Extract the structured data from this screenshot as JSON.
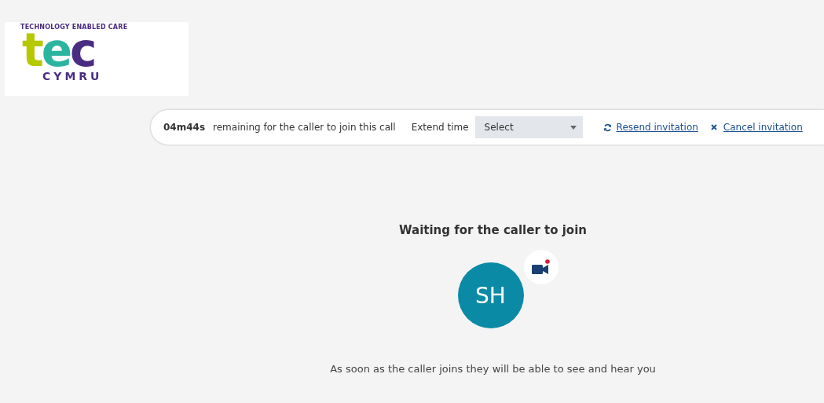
{
  "logo": {
    "tagline": "TECHNOLOGY ENABLED CARE",
    "letters": [
      {
        "text": "t",
        "color": "#b5c800"
      },
      {
        "text": "e",
        "color": "#2bb5a0"
      },
      {
        "text": "c",
        "color": "#4a2d82"
      }
    ],
    "subtitle": "CYMRU"
  },
  "timer_bar": {
    "time": "04m44s",
    "message": "remaining for the caller to join this call",
    "extend_label": "Extend time",
    "extend_select": {
      "value": "Select"
    },
    "resend": "Resend invitation",
    "cancel": "Cancel invitation"
  },
  "waiting": {
    "title": "Waiting for the caller to join",
    "avatar": "SH",
    "camera_recording": true,
    "note": "As soon as the caller joins they will be able to see and hear you"
  }
}
